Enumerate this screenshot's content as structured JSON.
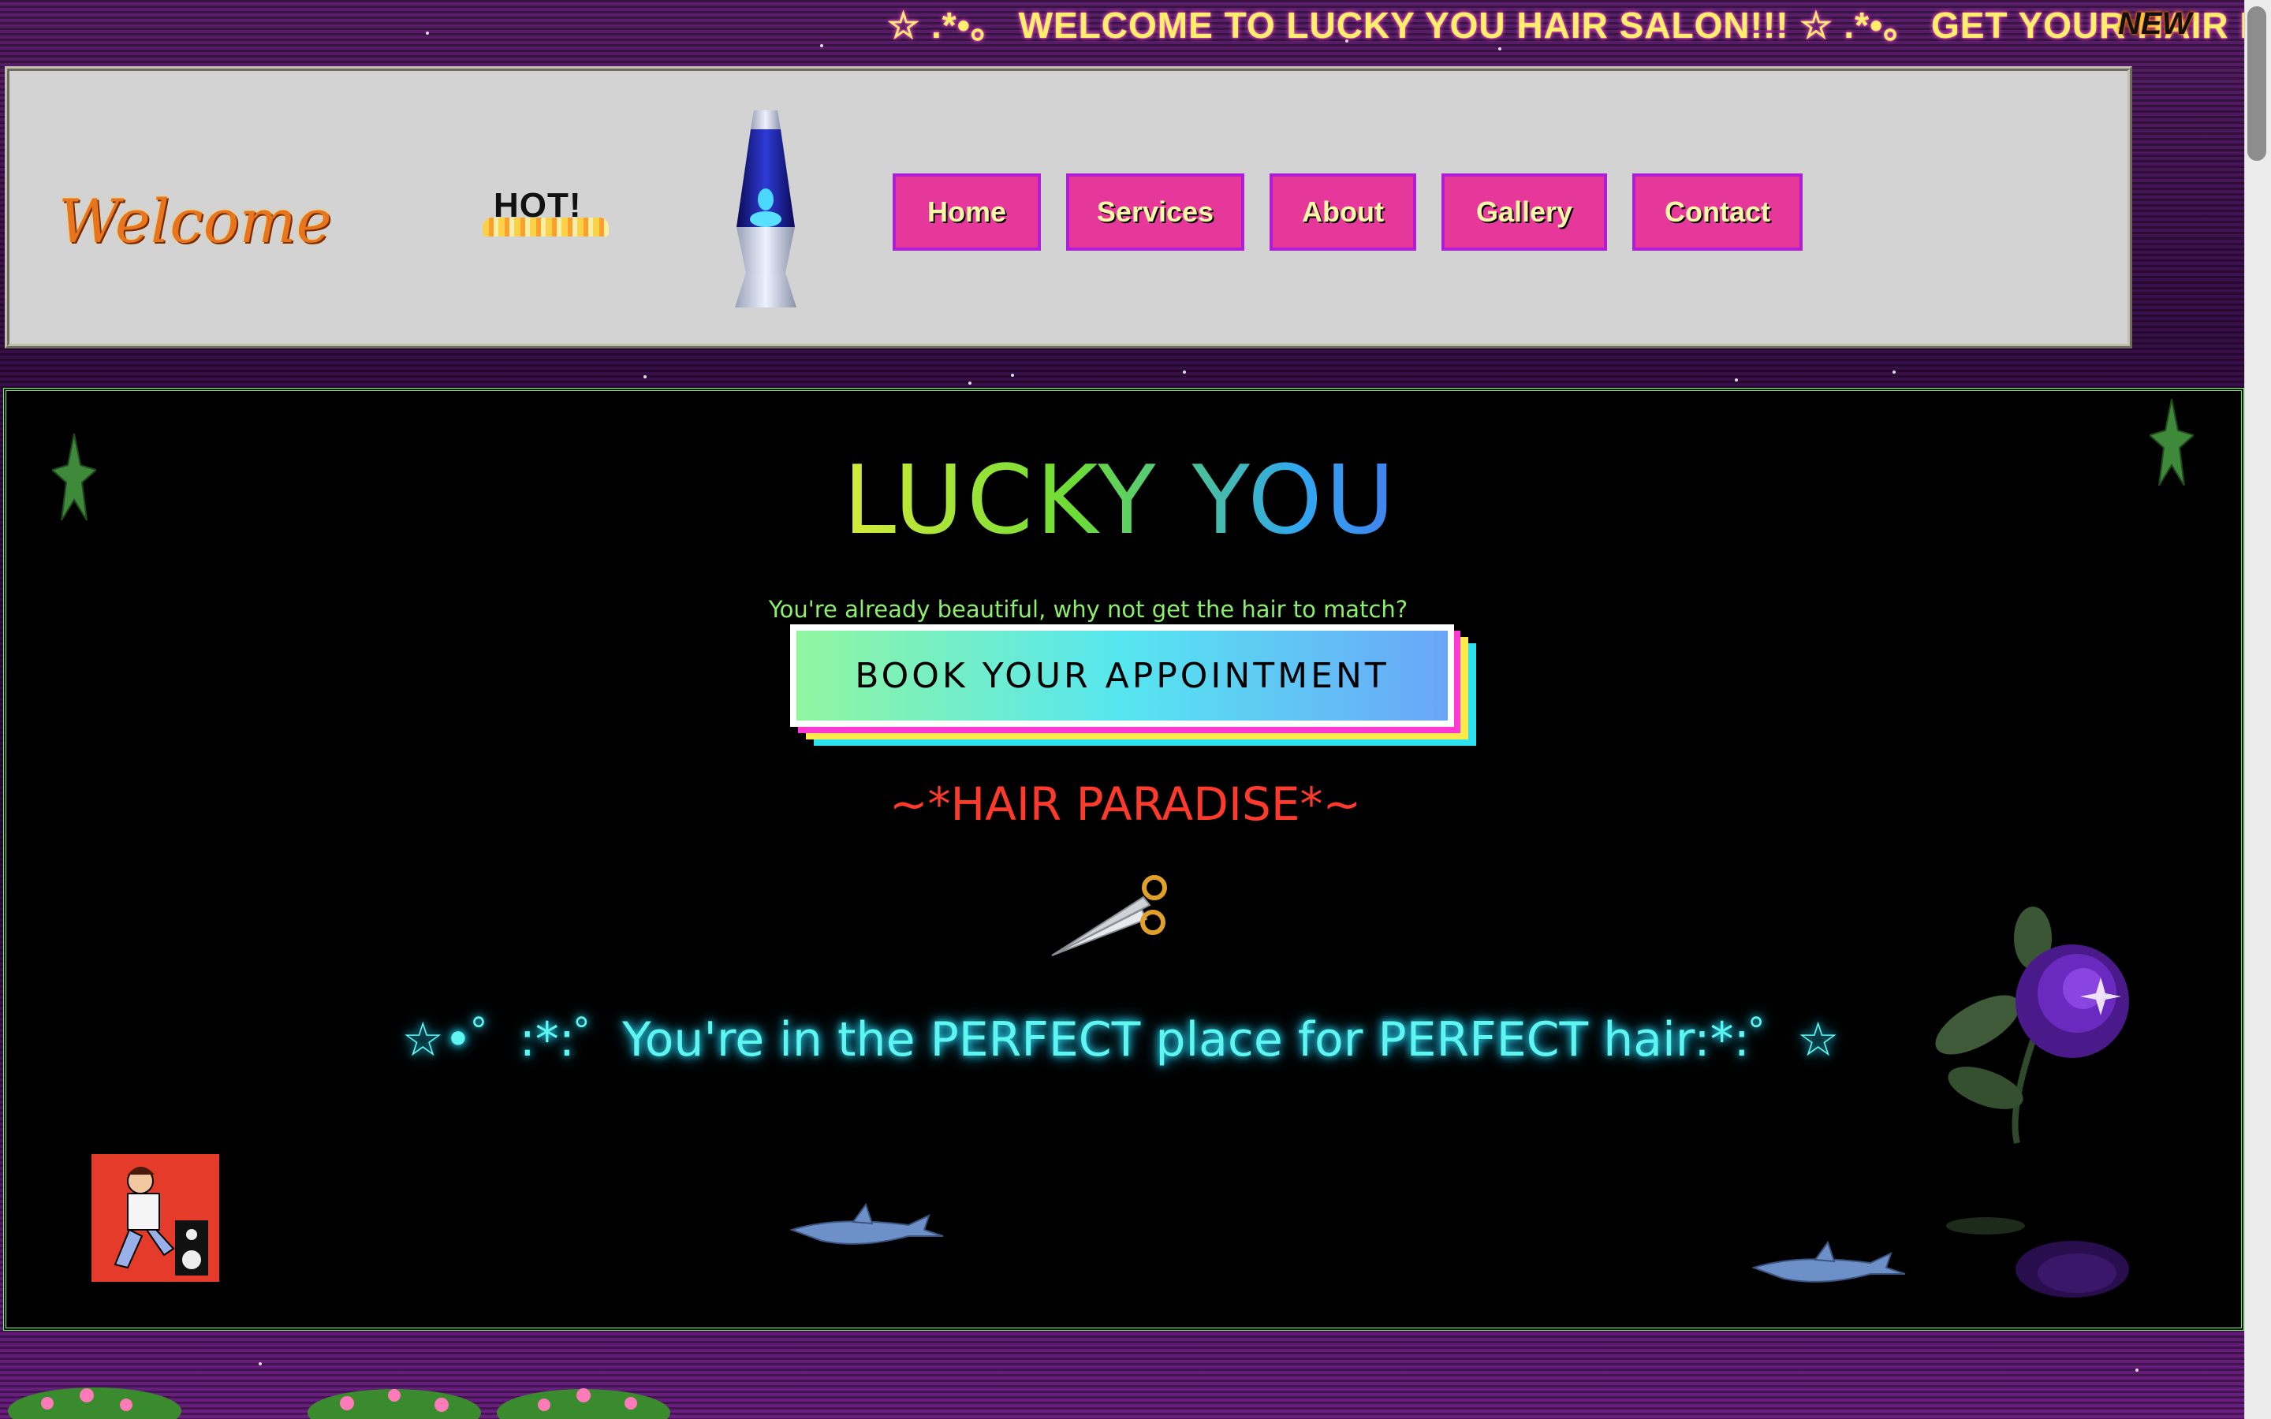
{
  "marquee": {
    "text": "☆ .*•。 WELCOME TO LUCKY YOU HAIR SALON!!! ☆ .*•。 GET YOUR HAIR DID!",
    "new_badge": "NEW"
  },
  "header": {
    "welcome": "Welcome",
    "hot_badge": "HOT!",
    "nav": [
      {
        "label": "Home"
      },
      {
        "label": "Services"
      },
      {
        "label": "About"
      },
      {
        "label": "Gallery"
      },
      {
        "label": "Contact"
      }
    ]
  },
  "main": {
    "title": "LUCKY YOU",
    "tagline": "You're already beautiful, why not get the hair to match?",
    "book_button": "BOOK YOUR APPOINTMENT",
    "hair_paradise": "~*HAIR PARADISE*~",
    "perfect_text": "☆•゜:*:゜You're in the PERFECT place for PERFECT hair:*:゜☆"
  },
  "colors": {
    "nav_button": "#e6389a",
    "nav_border": "#b01dd6",
    "nav_text": "#fff6a8",
    "hair_paradise": "#ff3a2a",
    "perfect_glow": "#5ff5f0",
    "main_border": "#6dff5c"
  },
  "icons": [
    "lava-lamp-icon",
    "scissors-icon",
    "star-icon",
    "rose-icon",
    "shark-icon",
    "dancer-icon"
  ]
}
